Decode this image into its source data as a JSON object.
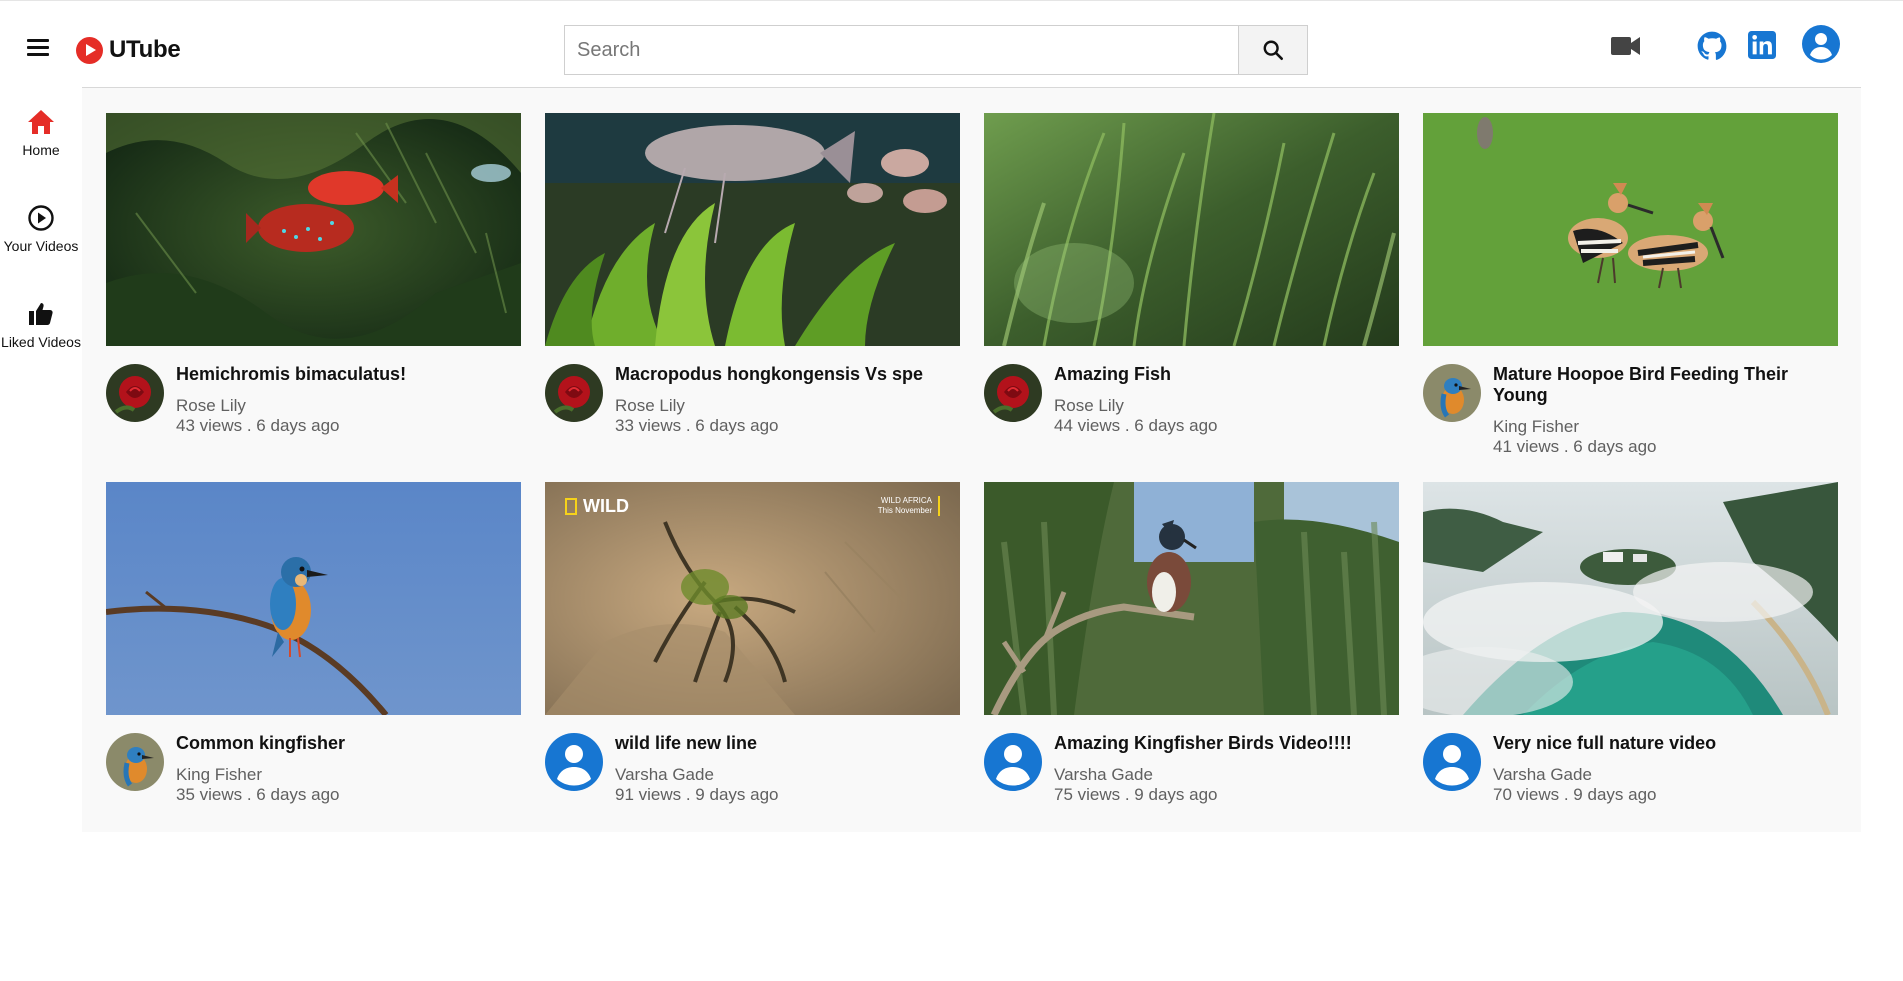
{
  "app": {
    "name": "UTube",
    "brand_color": "#e52d27",
    "accent_color": "#1776d2"
  },
  "header": {
    "search": {
      "placeholder": "Search",
      "value": ""
    },
    "icons": [
      "hamburger-menu-icon",
      "search-icon",
      "video-camera-icon",
      "github-icon",
      "linkedin-icon",
      "account-icon"
    ]
  },
  "sidebar": {
    "items": [
      {
        "label": "Home",
        "icon": "home-icon"
      },
      {
        "label": "Your Videos",
        "icon": "play-circle-icon"
      },
      {
        "label": "Liked Videos",
        "icon": "thumbs-up-icon"
      }
    ]
  },
  "videos": [
    {
      "title": "Hemichromis bimaculatus!",
      "channel": "Rose Lily",
      "stats": "43 views . 6 days ago",
      "avatar": "rose"
    },
    {
      "title": "Macropodus hongkongensis Vs spe",
      "channel": "Rose Lily",
      "stats": "33 views . 6 days ago",
      "avatar": "rose"
    },
    {
      "title": "Amazing Fish",
      "channel": "Rose Lily",
      "stats": "44 views . 6 days ago",
      "avatar": "rose"
    },
    {
      "title": "Mature Hoopoe Bird Feeding Their Young",
      "channel": "King Fisher",
      "stats": "41 views . 6 days ago",
      "avatar": "kingfisher"
    },
    {
      "title": "Common kingfisher",
      "channel": "King Fisher",
      "stats": "35 views . 6 days ago",
      "avatar": "kingfisher"
    },
    {
      "title": "wild life new line",
      "channel": "Varsha Gade",
      "stats": "91 views . 9 days ago",
      "avatar": "user",
      "badge": "WILD",
      "corner_text": [
        "WILD AFRICA",
        "This November"
      ]
    },
    {
      "title": "Amazing Kingfisher Birds Video!!!!",
      "channel": "Varsha Gade",
      "stats": "75 views . 9 days ago",
      "avatar": "user"
    },
    {
      "title": "Very nice full nature video",
      "channel": "Varsha Gade",
      "stats": "70 views . 9 days ago",
      "avatar": "user"
    }
  ]
}
